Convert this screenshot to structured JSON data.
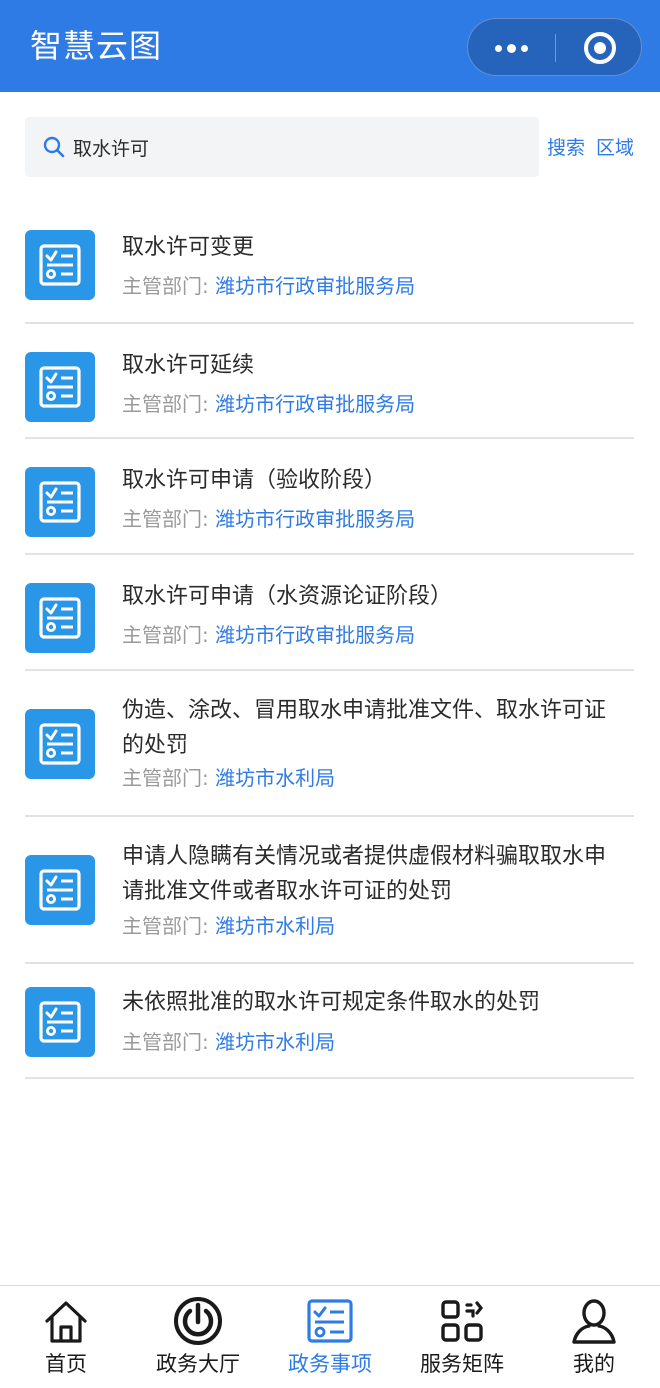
{
  "header": {
    "title": "智慧云图"
  },
  "search": {
    "value": "取水许可",
    "search_label": "搜索",
    "region_label": "区域"
  },
  "items": [
    {
      "title": "取水许可变更",
      "dept_label": "主管部门:",
      "dept": "潍坊市行政审批服务局"
    },
    {
      "title": "取水许可延续",
      "dept_label": "主管部门:",
      "dept": "潍坊市行政审批服务局"
    },
    {
      "title": "取水许可申请（验收阶段）",
      "dept_label": "主管部门:",
      "dept": "潍坊市行政审批服务局"
    },
    {
      "title": "取水许可申请（水资源论证阶段）",
      "dept_label": "主管部门:",
      "dept": "潍坊市行政审批服务局"
    },
    {
      "title": "伪造、涂改、冒用取水申请批准文件、取水许可证的处罚",
      "dept_label": "主管部门:",
      "dept": "潍坊市水利局"
    },
    {
      "title": "申请人隐瞒有关情况或者提供虚假材料骗取取水申请批准文件或者取水许可证的处罚",
      "dept_label": "主管部门:",
      "dept": "潍坊市水利局"
    },
    {
      "title": "未依照批准的取水许可规定条件取水的处罚",
      "dept_label": "主管部门:",
      "dept": "潍坊市水利局"
    }
  ],
  "tabbar": {
    "tabs": [
      {
        "label": "首页",
        "icon": "home-icon",
        "active": false
      },
      {
        "label": "政务大厅",
        "icon": "power-dial-icon",
        "active": false
      },
      {
        "label": "政务事项",
        "icon": "checklist-icon",
        "active": true
      },
      {
        "label": "服务矩阵",
        "icon": "qr-grid-icon",
        "active": false
      },
      {
        "label": "我的",
        "icon": "user-icon",
        "active": false
      }
    ]
  },
  "colors": {
    "primary": "#2f7be6",
    "item_icon_bg": "#2a96e8",
    "muted": "#9a9a9a"
  }
}
